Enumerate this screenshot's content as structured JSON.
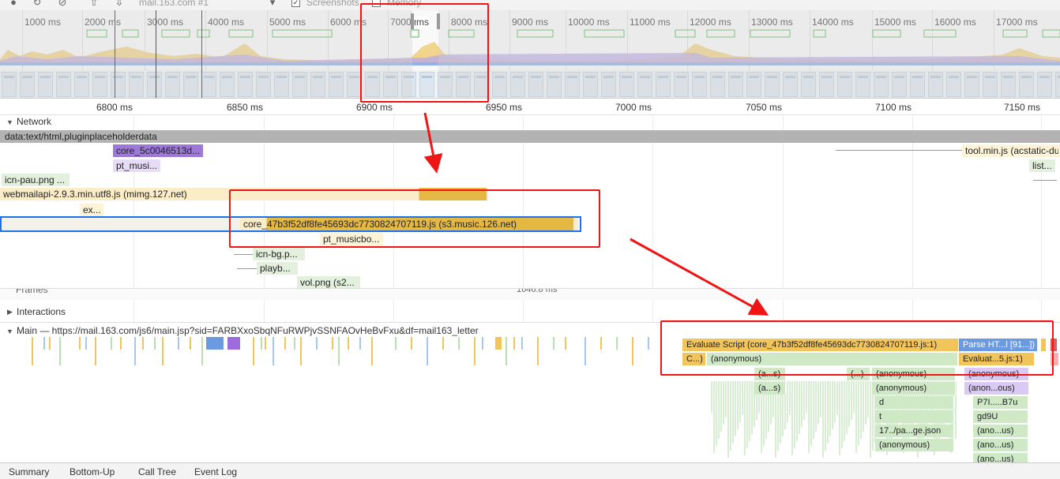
{
  "toolbar": {
    "record_icon": "record-icon",
    "reload_icon": "reload-icon",
    "clear_icon": "clear-icon",
    "upload_icon": "upload-icon",
    "download_icon": "download-icon",
    "profile_select": "mail.163.com #1",
    "screenshots_label": "Screenshots",
    "screenshots_checked": true,
    "memory_label": "Memory",
    "memory_checked": false
  },
  "overview": {
    "ticks": [
      "1000 ms",
      "2000 ms",
      "3000 ms",
      "4000 ms",
      "5000 ms",
      "6000 ms",
      "7000 ms",
      "8000 ms",
      "9000 ms",
      "10000 ms",
      "11000 ms",
      "12000 ms",
      "13000 ms",
      "14000 ms",
      "15000 ms",
      "16000 ms",
      "17000 ms"
    ],
    "selection_label": "ms"
  },
  "ruler": {
    "ticks": [
      "6800 ms",
      "6850 ms",
      "6900 ms",
      "6950 ms",
      "7000 ms",
      "7050 ms",
      "7100 ms",
      "7150 ms"
    ]
  },
  "network": {
    "title": "Network",
    "data_bar": "data:text/html,pluginplaceholderdata",
    "requests": [
      {
        "label": "core_5c0046513d...",
        "color": "#9c78d8"
      },
      {
        "label": "pt_musi...",
        "color": "#e6dcf5"
      },
      {
        "label": "icn-pau.png ...",
        "color": "#e3f0dd"
      },
      {
        "label": "webmailapi-2.9.3.min.utf8.js (mimg.127.net)",
        "color": "#fdf3d7"
      },
      {
        "label": "ex...",
        "color": "#fdf3d7"
      },
      {
        "label": "core_47b3f52df8fe45693dc7730824707119.js (s3.music.126.net)",
        "color": "#e5b843"
      },
      {
        "label": "pt_musicbo...",
        "color": "#fdf3d7"
      },
      {
        "label": "icn-bg.p...",
        "color": "#e3f0dd"
      },
      {
        "label": "playb...",
        "color": "#e3f0dd"
      },
      {
        "label": "vol.png (s2...",
        "color": "#e3f0dd"
      },
      {
        "label": "tool.min.js (acstatic-du",
        "color": "#fdf3d7"
      },
      {
        "label": "list...",
        "color": "#e3f0dd"
      }
    ]
  },
  "frames": {
    "title": "Frames",
    "time": "1646.8 ms"
  },
  "interactions": {
    "title": "Interactions"
  },
  "main": {
    "title": "Main — https://mail.163.com/js6/main.jsp?sid=FARBXxoSbqNFuRWPjvSSNFAOvHeBvFxu&df=mail163_letter",
    "flames": {
      "evaluate_script": "Evaluate Script (core_47b3f52df8fe45693dc7730824707119.js:1)",
      "parse_html": "Parse HT...l [91...])",
      "c_short": "C...)",
      "anonymous_1": "(anonymous)",
      "evaluate_short": "Evaluat...5.js:1)",
      "as_1": "(a...s)",
      "dots": "(...)",
      "anonymous_2": "(anonymous)",
      "anonymous_3": "(anonymous)",
      "as_2": "(a...s)",
      "anonymous_4": "(anonymous)",
      "anon_us_1": "(anon...ous)",
      "d": "d",
      "p7i": "P7I.....B7u",
      "t": "t",
      "gd9u": "gd9U",
      "page_json": "17../pa...ge.json",
      "ano_us_1": "(ano...us)",
      "anonymous_5": "(anonymous)",
      "ano_us_2": "(ano...us)",
      "ano_us_3": "(ano...us)"
    }
  },
  "bottom_tabs": [
    "Summary",
    "Bottom-Up",
    "Call Tree",
    "Event Log"
  ],
  "colors": {
    "annotation_red": "#f01414",
    "script_yellow": "#f2c55c",
    "parse_blue": "#6b9ae0",
    "function_green": "#cfe9c6",
    "function_purple": "#d9c9f3"
  }
}
